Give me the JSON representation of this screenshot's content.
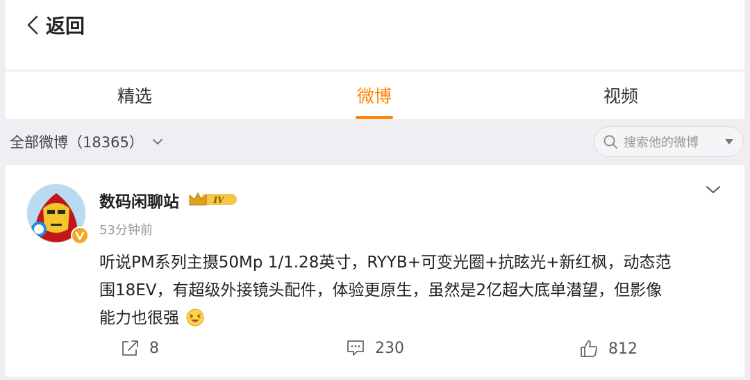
{
  "header": {
    "back_label": "返回"
  },
  "tabs": [
    {
      "label": "精选",
      "active": false
    },
    {
      "label": "微博",
      "active": true
    },
    {
      "label": "视频",
      "active": false
    }
  ],
  "filter": {
    "label": "全部微博（18365）"
  },
  "search": {
    "placeholder": "搜索他的微博"
  },
  "post": {
    "username": "数码闲聊站",
    "badge": "IV",
    "time": "53分钟前",
    "content_lines": [
      "听说PM系列主摄50Mp 1/1.28英寸，RYYB+可变光圈+抗眩光+新红枫，动态范",
      "围18EV，有超级外接镜头配件，体验更原生，虽然是2亿超大底单潜望，但影像",
      "能力也很强"
    ],
    "reposts": "8",
    "comments": "230",
    "likes": "812"
  },
  "colors": {
    "accent": "#ff8200",
    "background": "#efeff3"
  },
  "icons": [
    "back-arrow-icon",
    "chevron-down-icon",
    "search-icon",
    "dropdown-caret-icon",
    "repost-icon",
    "comment-icon",
    "like-icon",
    "verified-badge-icon",
    "vip-crown-icon",
    "laugh-emoji-icon"
  ]
}
